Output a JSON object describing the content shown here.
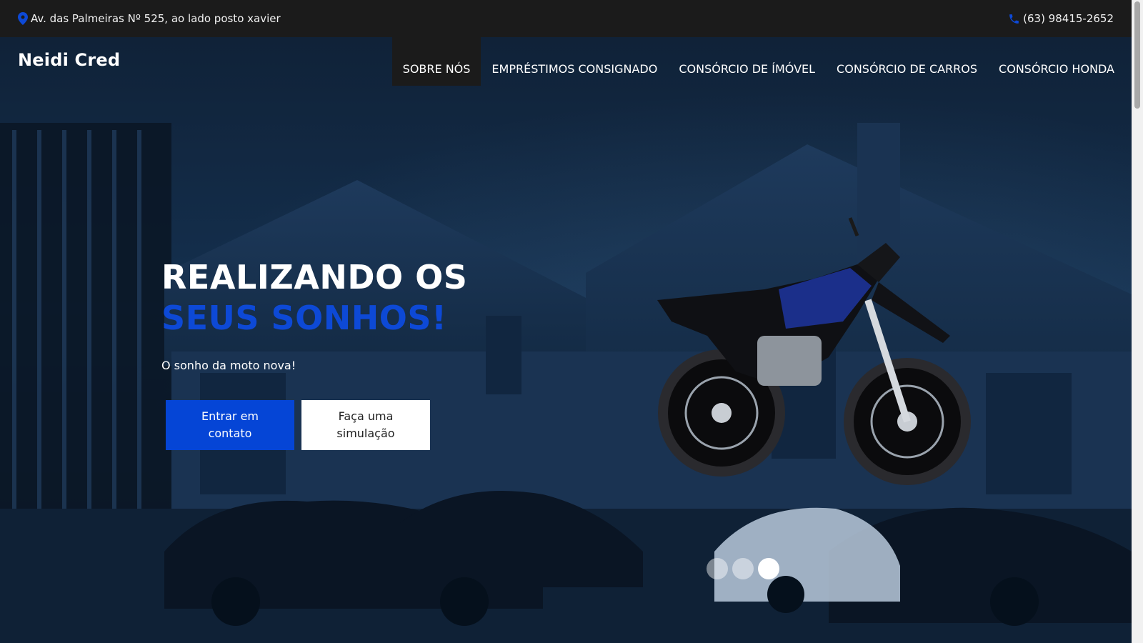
{
  "topbar": {
    "address": "Av. das Palmeiras Nº 525, ao lado posto xavier",
    "address_icon": "map-pin-icon",
    "phone": "(63) 98415-2652",
    "phone_icon": "phone-icon",
    "icon_color": "#0d49d6"
  },
  "header": {
    "brand": "Neidi Cred"
  },
  "nav": {
    "items": [
      {
        "label": "SOBRE NÓS"
      },
      {
        "label": "EMPRÉSTIMOS CONSIGNADO"
      },
      {
        "label": "CONSÓRCIO DE ÍMÓVEL"
      },
      {
        "label": "CONSÓRCIO DE CARROS"
      },
      {
        "label": "CONSÓRCIO HONDA"
      }
    ],
    "active_index": 0
  },
  "hero": {
    "headline_part1": "REALIZANDO OS",
    "headline_accent": "SEUS SONHOS!",
    "subtitle": "O sonho da moto nova!",
    "primary_button": "Entrar em contato",
    "secondary_button": "Faça uma simulação",
    "accent_color": "#0d49d6",
    "slides_total": 3,
    "active_slide": 3
  }
}
